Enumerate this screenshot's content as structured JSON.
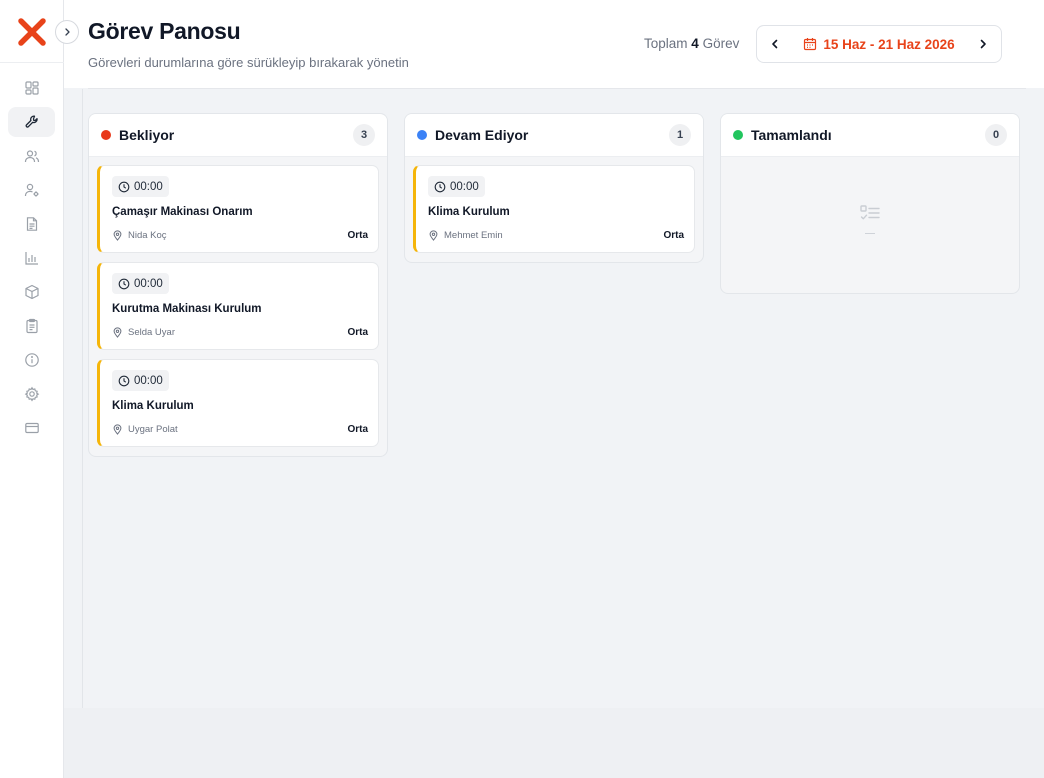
{
  "header": {
    "title": "Görev Panosu",
    "subtitle": "Görevleri durumlarına göre sürükleyip bırakarak yönetin",
    "total_prefix": "Toplam",
    "total_count": "4",
    "total_suffix": "Görev",
    "date_range": "15 Haz - 21 Haz 2026"
  },
  "colors": {
    "brand": "#e8431a",
    "waiting": "#e8381a",
    "in_progress": "#3b82f6",
    "done": "#22c55e",
    "card_accent": "#f5b50a"
  },
  "sidebar": {
    "logo": "x-logo",
    "items": [
      {
        "icon": "dashboard-icon",
        "active": false
      },
      {
        "icon": "wrench-icon",
        "active": true
      },
      {
        "icon": "users-icon",
        "active": false
      },
      {
        "icon": "user-settings-icon",
        "active": false
      },
      {
        "icon": "document-icon",
        "active": false
      },
      {
        "icon": "bar-chart-icon",
        "active": false
      },
      {
        "icon": "package-icon",
        "active": false
      },
      {
        "icon": "clipboard-icon",
        "active": false
      },
      {
        "icon": "info-icon",
        "active": false
      },
      {
        "icon": "gear-icon",
        "active": false
      },
      {
        "icon": "credit-card-icon",
        "active": false
      }
    ]
  },
  "columns": [
    {
      "title": "Bekliyor",
      "count": "3",
      "cards": [
        {
          "time": "00:00",
          "title": "Çamaşır Makinası Onarım",
          "person": "Nida Koç",
          "priority": "Orta"
        },
        {
          "time": "00:00",
          "title": "Kurutma Makinası Kurulum",
          "person": "Selda Uyar",
          "priority": "Orta"
        },
        {
          "time": "00:00",
          "title": "Klima Kurulum",
          "person": "Uygar Polat",
          "priority": "Orta"
        }
      ]
    },
    {
      "title": "Devam Ediyor",
      "count": "1",
      "cards": [
        {
          "time": "00:00",
          "title": "Klima Kurulum",
          "person": "Mehmet Emin",
          "priority": "Orta"
        }
      ]
    },
    {
      "title": "Tamamlandı",
      "count": "0",
      "cards": []
    }
  ]
}
